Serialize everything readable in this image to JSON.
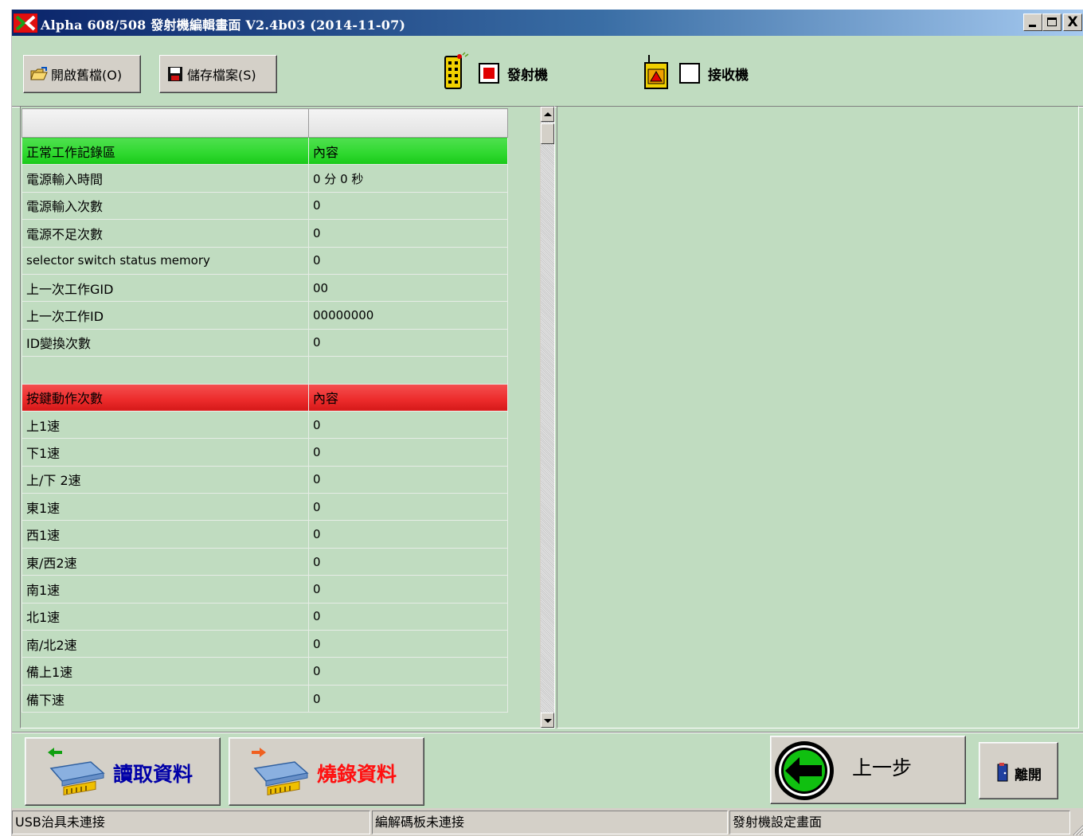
{
  "window": {
    "title": "Alpha 608/508  發射機編輯畫面   V2.4b03 (2014-11-07)",
    "caption_minimize": "_",
    "caption_maximize": "□",
    "caption_close": "X"
  },
  "toolbar": {
    "open_label": "開啟舊檔(O)",
    "save_label": "儲存檔案(S)",
    "transmitter_label": "發射機",
    "receiver_label": "接收機",
    "transmitter_checked": true,
    "receiver_checked": false
  },
  "table": {
    "header": [
      "",
      ""
    ],
    "section1": {
      "label": "正常工作記錄區",
      "value_header": "內容",
      "color": "#2ed82e"
    },
    "rows1": [
      {
        "label": "電源輸入時間",
        "value": "0 分  0 秒"
      },
      {
        "label": "電源輸入次數",
        "value": "0"
      },
      {
        "label": "電源不足次數",
        "value": "0"
      },
      {
        "label": "selector switch status memory",
        "value": "0"
      },
      {
        "label": "上一次工作GID",
        "value": "00"
      },
      {
        "label": "上一次工作ID",
        "value": "00000000"
      },
      {
        "label": "ID變換次數",
        "value": "0"
      },
      {
        "label": "",
        "value": ""
      }
    ],
    "section2": {
      "label": "按鍵動作次數",
      "value_header": "內容",
      "color": "#ec2b2b"
    },
    "rows2": [
      {
        "label": "上1速",
        "value": "0"
      },
      {
        "label": "下1速",
        "value": "0"
      },
      {
        "label": "上/下 2速",
        "value": "0"
      },
      {
        "label": "東1速",
        "value": "0"
      },
      {
        "label": "西1速",
        "value": "0"
      },
      {
        "label": "東/西2速",
        "value": "0"
      },
      {
        "label": "南1速",
        "value": "0"
      },
      {
        "label": "北1速",
        "value": "0"
      },
      {
        "label": "南/北2速",
        "value": "0"
      },
      {
        "label": "備上1速",
        "value": "0"
      },
      {
        "label": "備下速",
        "value": "0"
      }
    ]
  },
  "actions": {
    "read_label": "讀取資料",
    "burn_label": "燒錄資料",
    "back_label": "上一步",
    "exit_label": "離開"
  },
  "status": {
    "usb": "USB治具未連接",
    "decoder": "編解碼板未連接",
    "screen": "發射機設定畫面"
  },
  "colors": {
    "background": "#c0dcc0",
    "read_text": "#0000a8",
    "burn_text": "#ff1010"
  }
}
